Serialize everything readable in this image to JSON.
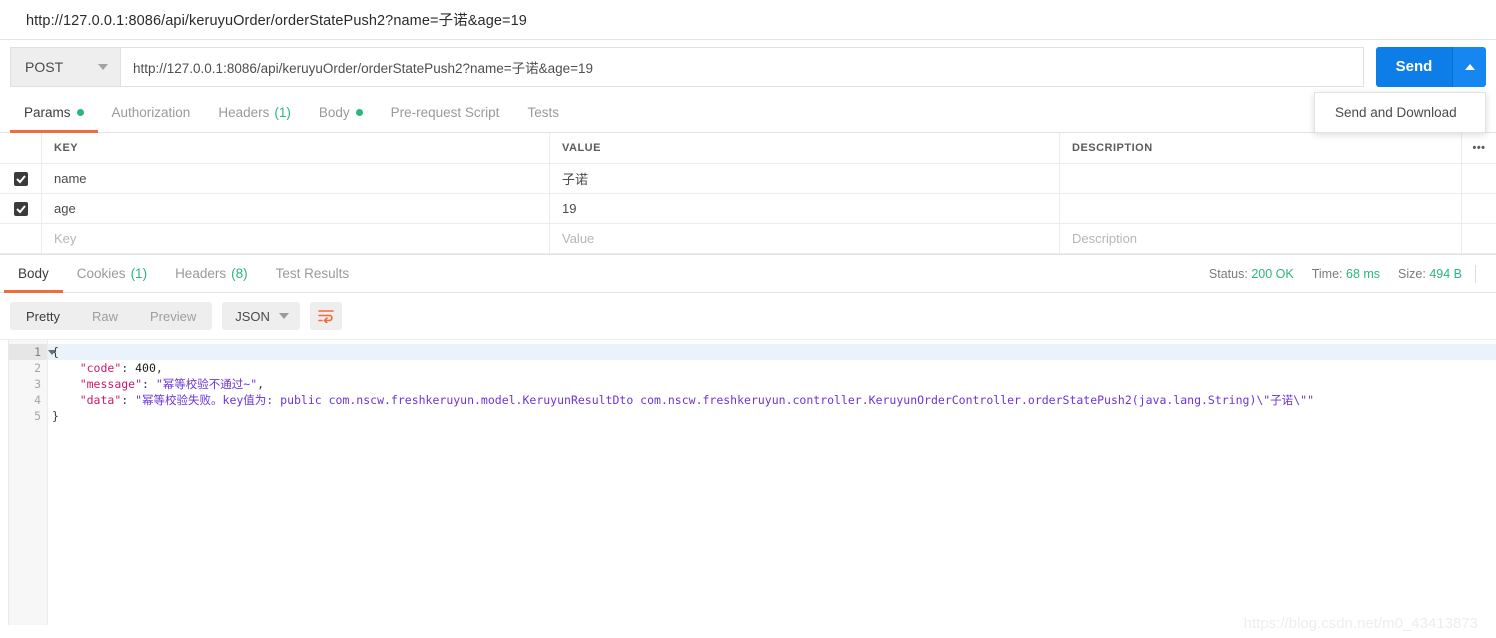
{
  "titlebar": {
    "url": "http://127.0.0.1:8086/api/keruyuOrder/orderStatePush2?name=子诺&age=19"
  },
  "request": {
    "method": "POST",
    "url": "http://127.0.0.1:8086/api/keruyuOrder/orderStatePush2?name=子诺&age=19",
    "send_label": "Send",
    "send_menu": [
      "Send and Download"
    ],
    "tabs": [
      {
        "label": "Params",
        "dot": true,
        "count": "",
        "active": true
      },
      {
        "label": "Authorization",
        "dot": false,
        "count": "",
        "active": false
      },
      {
        "label": "Headers",
        "dot": false,
        "count": "(1)",
        "active": false
      },
      {
        "label": "Body",
        "dot": true,
        "count": "",
        "active": false
      },
      {
        "label": "Pre-request Script",
        "dot": false,
        "count": "",
        "active": false
      },
      {
        "label": "Tests",
        "dot": false,
        "count": "",
        "active": false
      }
    ]
  },
  "params_table": {
    "headers": {
      "key": "KEY",
      "value": "VALUE",
      "description": "DESCRIPTION",
      "bulk": "•••"
    },
    "rows": [
      {
        "checked": true,
        "key": "name",
        "value": "子诺",
        "description": ""
      },
      {
        "checked": true,
        "key": "age",
        "value": "19",
        "description": ""
      }
    ],
    "placeholders": {
      "key": "Key",
      "value": "Value",
      "description": "Description"
    }
  },
  "response": {
    "tabs": [
      {
        "label": "Body",
        "count": "",
        "active": true
      },
      {
        "label": "Cookies",
        "count": "(1)",
        "active": false
      },
      {
        "label": "Headers",
        "count": "(8)",
        "active": false
      },
      {
        "label": "Test Results",
        "count": "",
        "active": false
      }
    ],
    "status_label": "Status:",
    "status_value": "200 OK",
    "time_label": "Time:",
    "time_value": "68 ms",
    "size_label": "Size:",
    "size_value": "494 B",
    "view_modes": [
      {
        "label": "Pretty",
        "active": true
      },
      {
        "label": "Raw",
        "active": false
      },
      {
        "label": "Preview",
        "active": false
      }
    ],
    "format": "JSON",
    "line_numbers": [
      "1",
      "2",
      "3",
      "4",
      "5"
    ],
    "body_lines": [
      [
        {
          "t": "punct",
          "s": "{"
        }
      ],
      [
        {
          "t": "punct",
          "s": "    "
        },
        {
          "t": "key",
          "s": "\"code\""
        },
        {
          "t": "punct",
          "s": ": "
        },
        {
          "t": "num",
          "s": "400"
        },
        {
          "t": "punct",
          "s": ","
        }
      ],
      [
        {
          "t": "punct",
          "s": "    "
        },
        {
          "t": "key",
          "s": "\"message\""
        },
        {
          "t": "punct",
          "s": ": "
        },
        {
          "t": "str",
          "s": "\"幂等校验不通过~\""
        },
        {
          "t": "punct",
          "s": ","
        }
      ],
      [
        {
          "t": "punct",
          "s": "    "
        },
        {
          "t": "key",
          "s": "\"data\""
        },
        {
          "t": "punct",
          "s": ": "
        },
        {
          "t": "str",
          "s": "\"幂等校验失败。key值为: public com.nscw.freshkeruyun.model.KeruyunResultDto com.nscw.freshkeruyun.controller.KeruyunOrderController.orderStatePush2(java.lang.String)\\\"子诺\\\"\""
        }
      ],
      [
        {
          "t": "punct",
          "s": "}"
        }
      ]
    ]
  },
  "watermark": "https://blog.csdn.net/m0_43413873",
  "colors": {
    "accent_orange": "#f26b3a",
    "send_blue": "#0d7ee8",
    "success_green": "#2ab87a"
  }
}
